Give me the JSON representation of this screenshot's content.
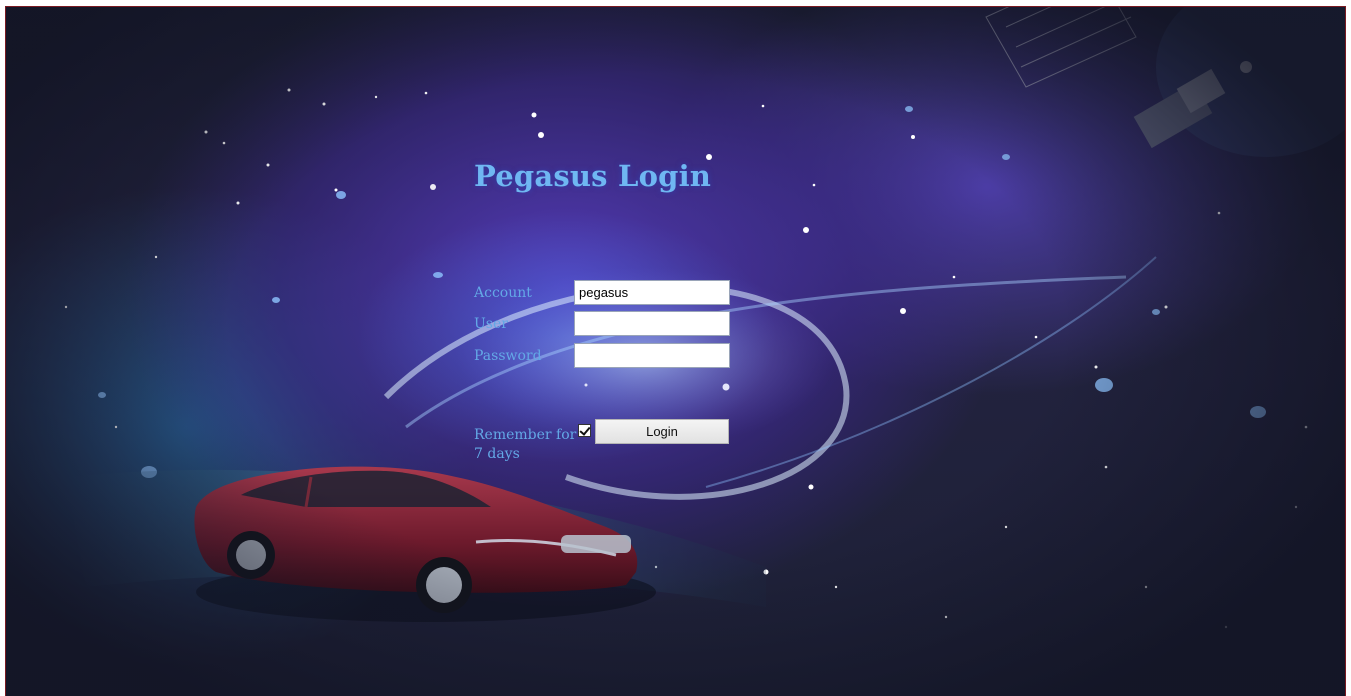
{
  "page": {
    "title": "Pegasus Login"
  },
  "form": {
    "account_label": "Account",
    "account_value": "pegasus",
    "user_label": "User",
    "user_value": "",
    "password_label": "Password",
    "password_value": "",
    "remember_label": "Remember for 7 days",
    "remember_checked": true,
    "login_label": "Login"
  },
  "colors": {
    "title": "#6fb7f2",
    "label": "#63a8e6",
    "frame_border": "#7a1a22"
  },
  "decor": {
    "background_image": "night sky with stars, light swirl, satellite and red sedan car"
  }
}
